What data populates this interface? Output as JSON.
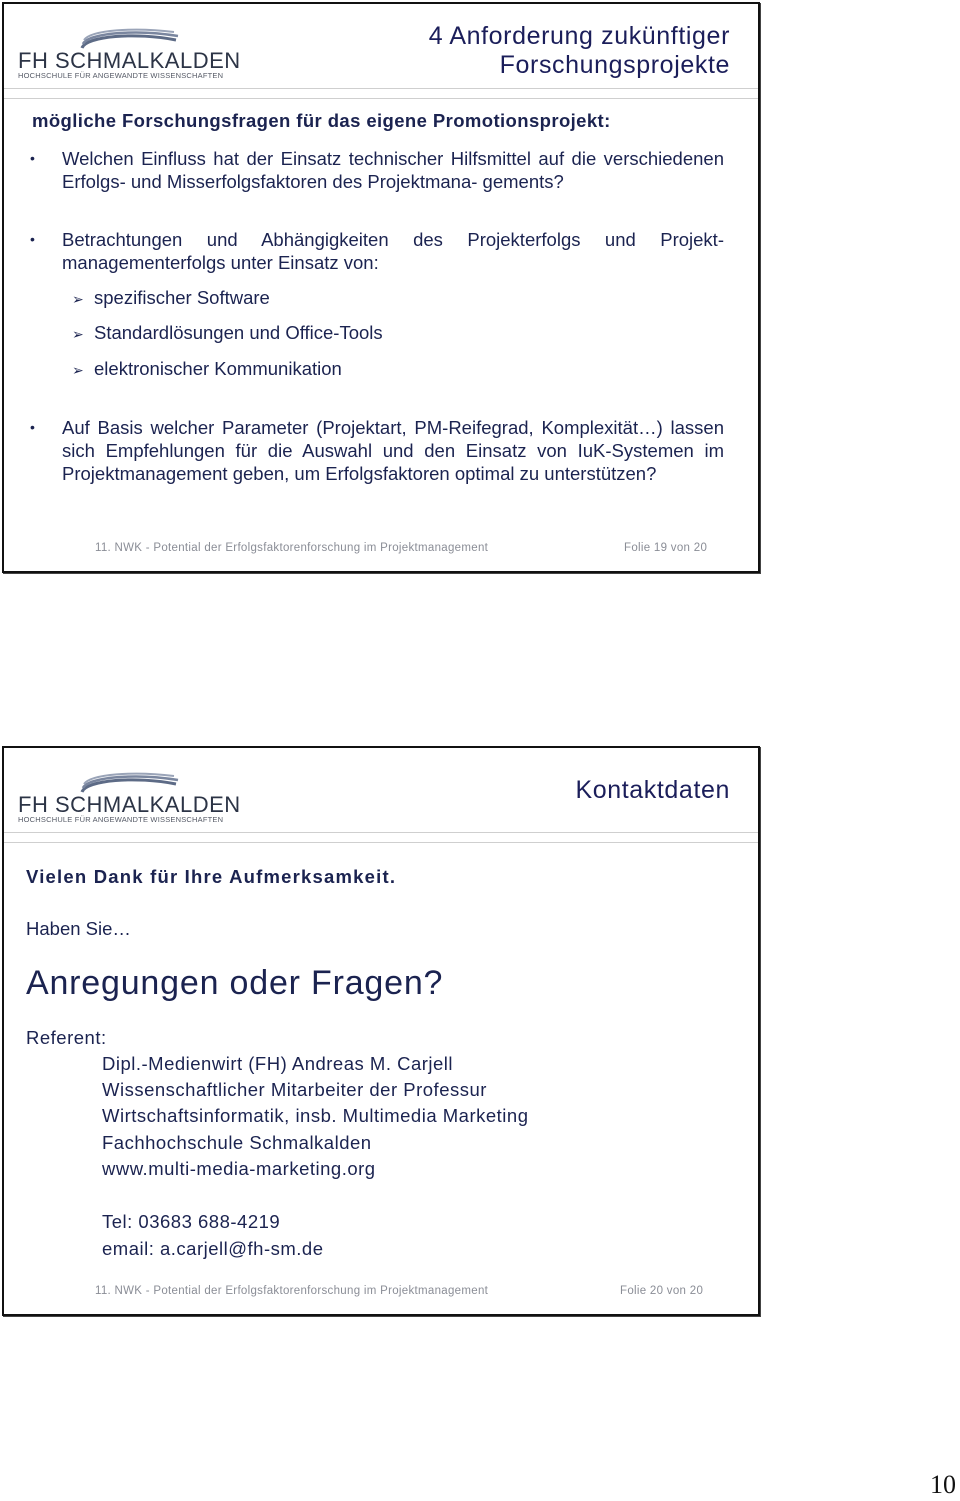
{
  "logo": {
    "name": "FH SCHMALKALDEN",
    "subtitle": "HOCHSCHULE FÜR ANGEWANDTE WISSENSCHAFTEN"
  },
  "slides": [
    {
      "title_line1": "4 Anforderung zukünftiger",
      "title_line2": "Forschungsprojekte",
      "heading": "mögliche Forschungsfragen für das eigene Promotionsprojekt:",
      "bullets": [
        {
          "marker": "•",
          "text": "Welchen Einfluss hat der Einsatz technischer Hilfsmittel auf die verschiedenen Erfolgs- und Misserfolgsfaktoren des Projektmana- gements?"
        },
        {
          "marker": "•",
          "text": "Betrachtungen und Abhängigkeiten des Projekterfolgs und Projekt- managementerfolgs unter Einsatz von:"
        },
        {
          "marker": "•",
          "text": "Auf Basis welcher Parameter (Projektart, PM-Reifegrad, Komplexität…) lassen sich Empfehlungen für die Auswahl und den Einsatz von IuK-Systemen im Projektmanagement geben, um Erfolgsfaktoren optimal zu unterstützen?"
        }
      ],
      "sub_items": [
        {
          "marker": "➢",
          "text": "spezifischer Software"
        },
        {
          "marker": "➢",
          "text": "Standardlösungen und Office-Tools"
        },
        {
          "marker": "➢",
          "text": "elektronischer Kommunikation"
        }
      ],
      "footer_left": "11. NWK - Potential der Erfolgsfaktorenforschung im Projektmanagement",
      "footer_right": "Folie 19 von 20"
    },
    {
      "title": "Kontaktdaten",
      "thanks": "Vielen Dank für Ihre Aufmerksamkeit.",
      "haben": "Haben Sie…",
      "anregungen": "Anregungen oder Fragen?",
      "referent_label": "Referent:",
      "referent_lines": [
        "Dipl.-Medienwirt (FH) Andreas M. Carjell",
        "Wissenschaftlicher Mitarbeiter der Professur",
        "Wirtschaftsinformatik, insb. Multimedia Marketing",
        "Fachhochschule Schmalkalden",
        "www.multi-media-marketing.org"
      ],
      "tel": "Tel: 03683 688-4219",
      "email": "email: a.carjell@fh-sm.de",
      "footer_left": "11. NWK - Potential der Erfolgsfaktorenforschung im Projektmanagement",
      "footer_right": "Folie 20 von  20"
    }
  ],
  "page_number": "10",
  "colors": {
    "title": "#1b1e5a",
    "body_text": "#1b2350",
    "footer_text": "#8a8d96",
    "separator": "#cfcfcf",
    "border": "#111111"
  }
}
